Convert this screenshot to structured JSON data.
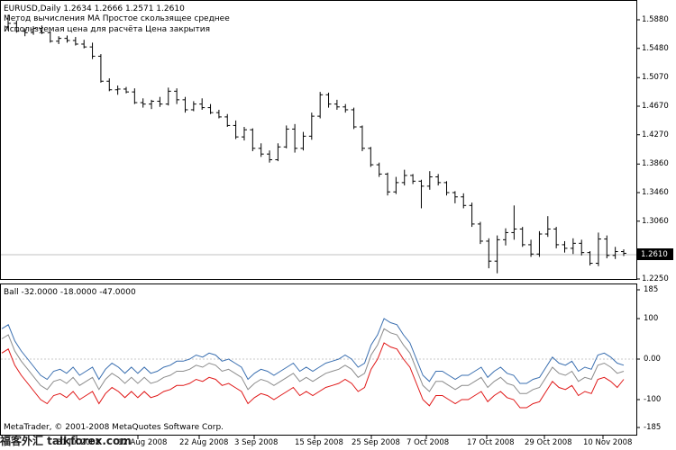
{
  "main_chart": {
    "symbol_line": "EURUSD,Daily  1.2634 1.2666 1.2571 1.2610",
    "info_line1": "Метод вычисления MA Простое скользящее среднее",
    "info_line2": "Используемая цена для расчёта Цена закрытия",
    "price_ticks": [
      "1.5880",
      "1.5480",
      "1.5070",
      "1.4670",
      "1.4270",
      "1.3860",
      "1.3460",
      "1.3060",
      "1.2250"
    ],
    "current_price": "1.2610",
    "y_range": [
      1.225,
      1.588
    ]
  },
  "indicator": {
    "label": "Ball -32.0000 -18.0000 -47.0000",
    "ticks": [
      "185",
      "100",
      "0.00",
      "-100",
      "-185"
    ],
    "y_range": [
      -185,
      185
    ],
    "colors": {
      "blue": "#3a6fb0",
      "gray": "#8c8c8c",
      "red": "#e01818"
    }
  },
  "date_labels": [
    "31 Jul 2008",
    "12 Aug 2008",
    "22 Aug 2008",
    "3 Sep 2008",
    "15 Sep 2008",
    "25 Sep 2008",
    "7 Oct 2008",
    "17 Oct 2008",
    "29 Oct 2008",
    "10 Nov 2008"
  ],
  "footer_copyright": "MetaTrader, © 2001-2008 MetaQuotes Software Corp.",
  "watermark_text": "福客外汇 talkforex.com",
  "chart_data": [
    {
      "type": "bar",
      "title": "EURUSD,Daily",
      "x_label": "",
      "y_label": "",
      "ylim": [
        1.225,
        1.588
      ],
      "bars": [
        [
          1.578,
          1.595,
          1.573,
          1.583
        ],
        [
          1.583,
          1.587,
          1.57,
          1.572
        ],
        [
          1.572,
          1.576,
          1.565,
          1.57
        ],
        [
          1.57,
          1.579,
          1.567,
          1.576
        ],
        [
          1.576,
          1.58,
          1.568,
          1.57
        ],
        [
          1.57,
          1.572,
          1.556,
          1.558
        ],
        [
          1.558,
          1.565,
          1.554,
          1.562
        ],
        [
          1.562,
          1.566,
          1.556,
          1.559
        ],
        [
          1.559,
          1.564,
          1.552,
          1.554
        ],
        [
          1.554,
          1.56,
          1.548,
          1.55
        ],
        [
          1.55,
          1.556,
          1.533,
          1.537
        ],
        [
          1.537,
          1.54,
          1.5,
          1.502
        ],
        [
          1.502,
          1.506,
          1.488,
          1.49
        ],
        [
          1.49,
          1.496,
          1.483,
          1.491
        ],
        [
          1.491,
          1.494,
          1.485,
          1.487
        ],
        [
          1.487,
          1.492,
          1.47,
          1.472
        ],
        [
          1.472,
          1.478,
          1.465,
          1.47
        ],
        [
          1.47,
          1.476,
          1.463,
          1.474
        ],
        [
          1.474,
          1.48,
          1.466,
          1.47
        ],
        [
          1.47,
          1.493,
          1.468,
          1.488
        ],
        [
          1.488,
          1.492,
          1.47,
          1.476
        ],
        [
          1.476,
          1.48,
          1.458,
          1.462
        ],
        [
          1.462,
          1.474,
          1.46,
          1.47
        ],
        [
          1.47,
          1.478,
          1.462,
          1.465
        ],
        [
          1.465,
          1.47,
          1.456,
          1.458
        ],
        [
          1.458,
          1.462,
          1.45,
          1.452
        ],
        [
          1.452,
          1.456,
          1.438,
          1.44
        ],
        [
          1.44,
          1.447,
          1.421,
          1.424
        ],
        [
          1.424,
          1.438,
          1.419,
          1.434
        ],
        [
          1.434,
          1.436,
          1.404,
          1.408
        ],
        [
          1.408,
          1.415,
          1.396,
          1.4
        ],
        [
          1.4,
          1.405,
          1.388,
          1.392
        ],
        [
          1.392,
          1.415,
          1.39,
          1.41
        ],
        [
          1.41,
          1.44,
          1.408,
          1.435
        ],
        [
          1.435,
          1.442,
          1.402,
          1.408
        ],
        [
          1.408,
          1.431,
          1.405,
          1.425
        ],
        [
          1.425,
          1.458,
          1.42,
          1.453
        ],
        [
          1.453,
          1.487,
          1.45,
          1.483
        ],
        [
          1.483,
          1.486,
          1.465,
          1.47
        ],
        [
          1.47,
          1.476,
          1.462,
          1.466
        ],
        [
          1.466,
          1.47,
          1.458,
          1.462
        ],
        [
          1.462,
          1.465,
          1.435,
          1.438
        ],
        [
          1.438,
          1.44,
          1.404,
          1.408
        ],
        [
          1.408,
          1.41,
          1.382,
          1.385
        ],
        [
          1.385,
          1.388,
          1.368,
          1.372
        ],
        [
          1.372,
          1.374,
          1.342,
          1.347
        ],
        [
          1.347,
          1.368,
          1.344,
          1.36
        ],
        [
          1.36,
          1.378,
          1.356,
          1.37
        ],
        [
          1.37,
          1.372,
          1.358,
          1.362
        ],
        [
          1.362,
          1.364,
          1.324,
          1.355
        ],
        [
          1.355,
          1.376,
          1.35,
          1.368
        ],
        [
          1.368,
          1.372,
          1.356,
          1.36
        ],
        [
          1.36,
          1.362,
          1.342,
          1.346
        ],
        [
          1.346,
          1.348,
          1.331,
          1.34
        ],
        [
          1.34,
          1.345,
          1.324,
          1.328
        ],
        [
          1.328,
          1.332,
          1.298,
          1.302
        ],
        [
          1.302,
          1.305,
          1.274,
          1.278
        ],
        [
          1.278,
          1.282,
          1.24,
          1.25
        ],
        [
          1.25,
          1.286,
          1.233,
          1.28
        ],
        [
          1.28,
          1.296,
          1.272,
          1.29
        ],
        [
          1.29,
          1.328,
          1.28,
          1.295
        ],
        [
          1.295,
          1.298,
          1.27,
          1.273
        ],
        [
          1.273,
          1.28,
          1.256,
          1.26
        ],
        [
          1.26,
          1.292,
          1.256,
          1.288
        ],
        [
          1.288,
          1.313,
          1.284,
          1.295
        ],
        [
          1.295,
          1.298,
          1.268,
          1.273
        ],
        [
          1.273,
          1.278,
          1.262,
          1.268
        ],
        [
          1.268,
          1.282,
          1.26,
          1.275
        ],
        [
          1.275,
          1.28,
          1.258,
          1.262
        ],
        [
          1.262,
          1.264,
          1.244,
          1.247
        ],
        [
          1.247,
          1.29,
          1.243,
          1.281
        ],
        [
          1.281,
          1.286,
          1.254,
          1.258
        ],
        [
          1.258,
          1.27,
          1.253,
          1.2634
        ],
        [
          1.2634,
          1.2666,
          1.2571,
          1.261
        ]
      ]
    },
    {
      "type": "line",
      "title": "Ball -32.0000 -18.0000 -47.0000",
      "x_label": "",
      "y_label": "",
      "ylim": [
        -185,
        185
      ],
      "series": [
        {
          "values": [
            75,
            85,
            45,
            20,
            0,
            -20,
            -40,
            -50,
            -30,
            -25,
            -35,
            -20,
            -40,
            -30,
            -20,
            -50,
            -25,
            -10,
            -20,
            -35,
            -20,
            -35,
            -20,
            -35,
            -30,
            -20,
            -15,
            -5,
            -5,
            0,
            10,
            5,
            15,
            10,
            -5,
            0,
            -10,
            -20,
            -50,
            -35,
            -25,
            -30,
            -40,
            -30,
            -20,
            -10,
            -30,
            -20,
            -30,
            -20,
            -10,
            -5,
            0,
            10,
            0,
            -20,
            -10,
            35,
            60,
            100,
            90,
            85,
            60,
            40,
            0,
            -40,
            -55,
            -30,
            -30,
            -40,
            -50,
            -40,
            -40,
            -30,
            -20,
            -45,
            -30,
            -20,
            -35,
            -40,
            -60,
            -60,
            -50,
            -45,
            -20,
            5,
            -10,
            -15,
            -5,
            -30,
            -20,
            -25,
            10,
            15,
            5,
            -10,
            -15
          ]
        },
        {
          "values": [
            50,
            60,
            20,
            -5,
            -25,
            -45,
            -65,
            -75,
            -55,
            -50,
            -60,
            -45,
            -65,
            -55,
            -45,
            -75,
            -50,
            -35,
            -45,
            -60,
            -45,
            -60,
            -45,
            -60,
            -55,
            -45,
            -40,
            -30,
            -30,
            -25,
            -15,
            -20,
            -10,
            -15,
            -30,
            -25,
            -35,
            -45,
            -75,
            -60,
            -50,
            -55,
            -65,
            -55,
            -45,
            -35,
            -55,
            -45,
            -55,
            -45,
            -35,
            -30,
            -25,
            -15,
            -25,
            -45,
            -35,
            10,
            35,
            75,
            65,
            60,
            35,
            15,
            -25,
            -65,
            -80,
            -55,
            -55,
            -65,
            -75,
            -65,
            -65,
            -55,
            -45,
            -70,
            -55,
            -45,
            -60,
            -65,
            -85,
            -85,
            -75,
            -70,
            -45,
            -20,
            -35,
            -40,
            -30,
            -55,
            -45,
            -50,
            -15,
            -10,
            -20,
            -35,
            -30
          ]
        },
        {
          "values": [
            15,
            25,
            -15,
            -40,
            -60,
            -80,
            -100,
            -110,
            -90,
            -85,
            -95,
            -80,
            -100,
            -90,
            -80,
            -110,
            -85,
            -70,
            -80,
            -95,
            -80,
            -95,
            -80,
            -95,
            -90,
            -80,
            -75,
            -65,
            -65,
            -60,
            -50,
            -55,
            -45,
            -50,
            -65,
            -60,
            -70,
            -80,
            -110,
            -95,
            -85,
            -90,
            -100,
            -90,
            -80,
            -70,
            -90,
            -80,
            -90,
            -80,
            -70,
            -65,
            -60,
            -50,
            -60,
            -80,
            -70,
            -25,
            0,
            40,
            30,
            25,
            0,
            -20,
            -60,
            -100,
            -115,
            -90,
            -90,
            -100,
            -110,
            -100,
            -100,
            -90,
            -80,
            -105,
            -90,
            -80,
            -95,
            -100,
            -120,
            -120,
            -110,
            -105,
            -80,
            -55,
            -70,
            -75,
            -65,
            -90,
            -80,
            -85,
            -50,
            -45,
            -55,
            -70,
            -50
          ]
        }
      ]
    }
  ]
}
